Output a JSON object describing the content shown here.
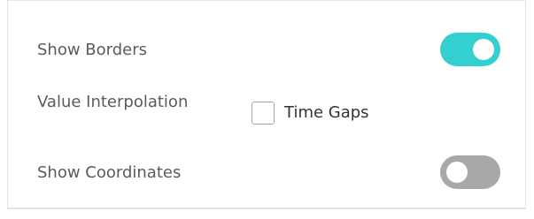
{
  "settings": {
    "show_borders": {
      "label": "Show Borders",
      "enabled": true
    },
    "value_interpolation": {
      "label": "Value Interpolation",
      "option_label": "Time Gaps",
      "checked": false
    },
    "show_coordinates": {
      "label": "Show Coordinates",
      "enabled": false
    }
  },
  "colors": {
    "toggle_on": "#34cfd0",
    "toggle_off": "#a8a8a8",
    "label_text": "#5b5b5b",
    "option_text": "#333333"
  }
}
